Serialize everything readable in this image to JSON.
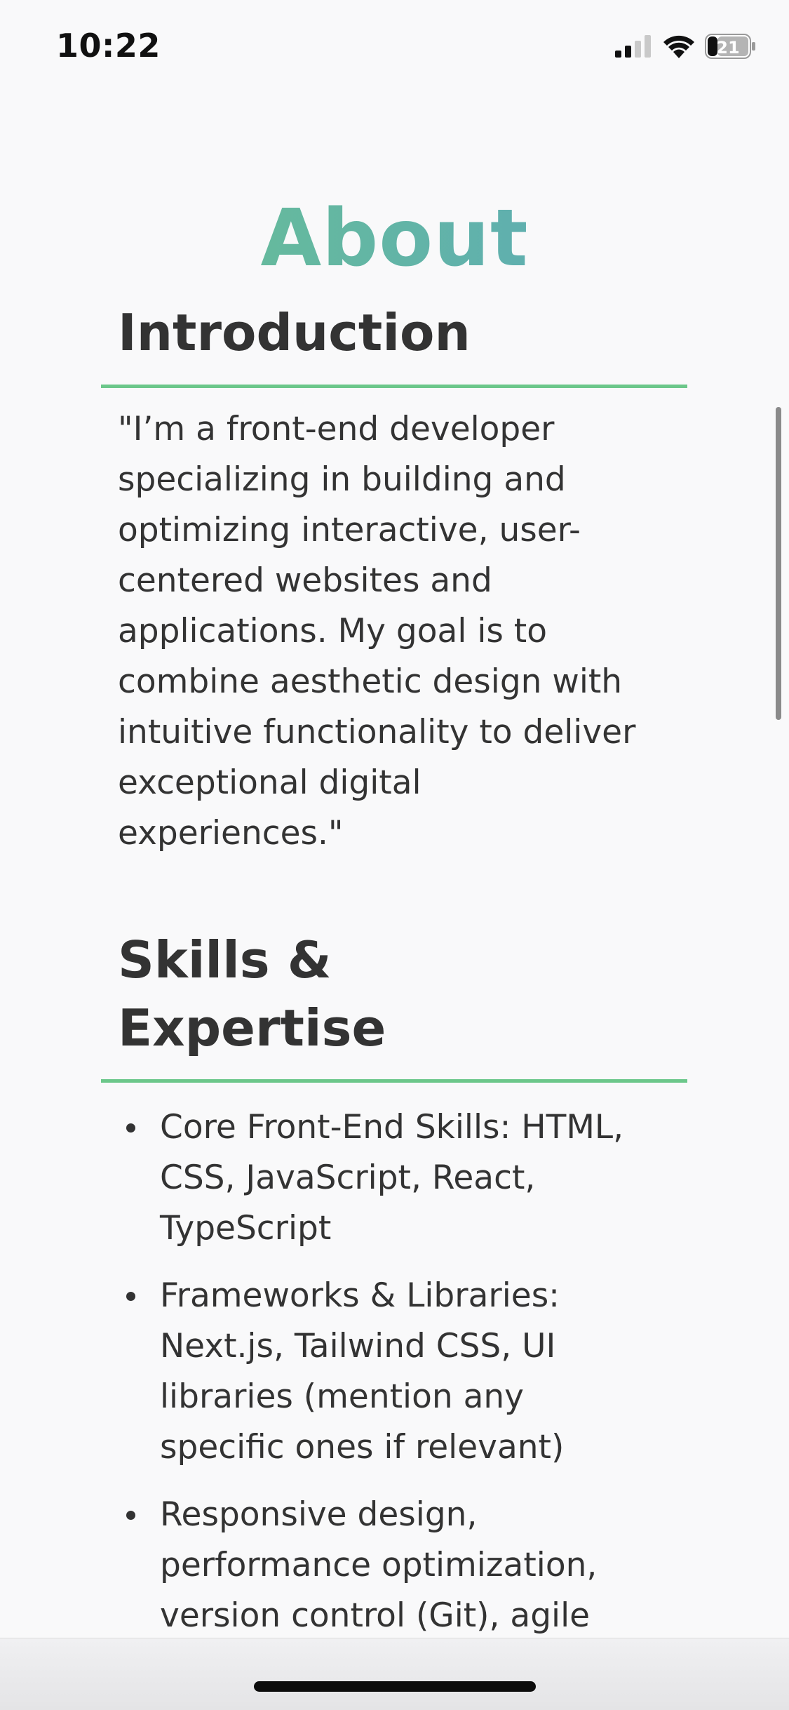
{
  "status_bar": {
    "time": "10:22",
    "battery_level": "21",
    "icons": [
      "signal-icon",
      "wifi-icon",
      "battery-icon"
    ]
  },
  "page": {
    "title": "About",
    "title_gradient": [
      "#6bc38d",
      "#5aa6bf"
    ],
    "accent_color": "#6cc78a"
  },
  "introduction": {
    "heading": "Introduction",
    "text": "\"I’m a front-end developer specializing in building and optimizing interactive, user-centered websites and applications. My goal is to combine aesthetic design with intuitive functionality to deliver exceptional digital experiences.\""
  },
  "skills": {
    "heading": "Skills & Expertise",
    "items": [
      "Core Front-End Skills: HTML, CSS, JavaScript, React, TypeScript",
      "Frameworks & Libraries: Next.js, Tailwind CSS, UI libraries (mention any specific ones if relevant)",
      "Responsive design, performance optimization, version control (Git), agile"
    ]
  }
}
